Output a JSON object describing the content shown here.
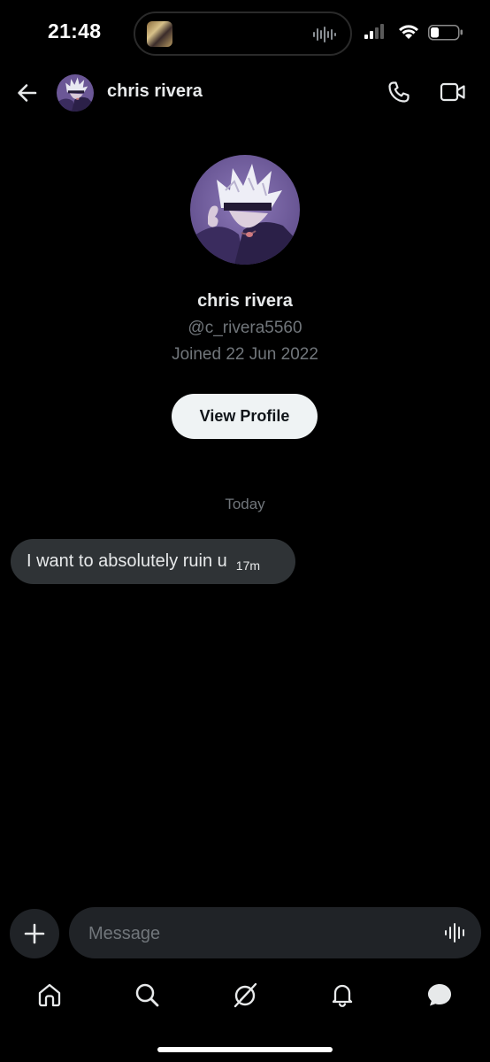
{
  "status_bar": {
    "time": "21:48"
  },
  "header": {
    "contact_name": "chris rivera",
    "avatar_icon": "avatar-anime-character",
    "back_icon": "arrow-left-icon",
    "call_icon": "phone-icon",
    "video_icon": "video-camera-icon"
  },
  "profile": {
    "name": "chris rivera",
    "handle": "@c_rivera5560",
    "joined": "Joined 22 Jun 2022",
    "view_profile_label": "View Profile"
  },
  "conversation": {
    "date_divider": "Today",
    "messages": [
      {
        "text": "I want to absolutely ruin u",
        "time": "17m",
        "direction": "incoming"
      }
    ]
  },
  "composer": {
    "placeholder": "Message"
  },
  "bottom_nav": {
    "items": [
      "home-icon",
      "search-icon",
      "grok-icon",
      "notifications-icon",
      "messages-icon"
    ],
    "active": "messages-icon"
  },
  "colors": {
    "background": "#000000",
    "bubble": "#2f3336",
    "secondary_text": "#71767b",
    "button_light": "#eff3f4"
  }
}
